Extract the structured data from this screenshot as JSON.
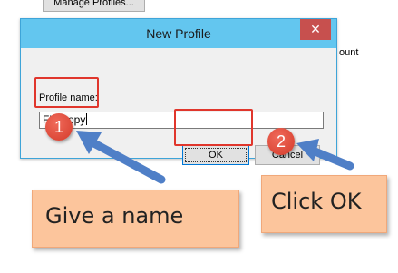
{
  "background": {
    "manage_profiles_label": "Manage Profiles...",
    "partial_text": "ount"
  },
  "dialog": {
    "title": "New Profile",
    "close_symbol": "✕",
    "profile_name_label": "Profile name:",
    "profile_name_value": "FileCopy",
    "ok_label": "OK",
    "cancel_label": "Cancel"
  },
  "annotations": {
    "step1_number": "1",
    "step2_number": "2",
    "step1_note": "Give a name",
    "step2_note": "Click OK",
    "highlight_color": "#e0362c",
    "arrow_color": "#4f7fc7",
    "note_color": "#fcc59c"
  }
}
